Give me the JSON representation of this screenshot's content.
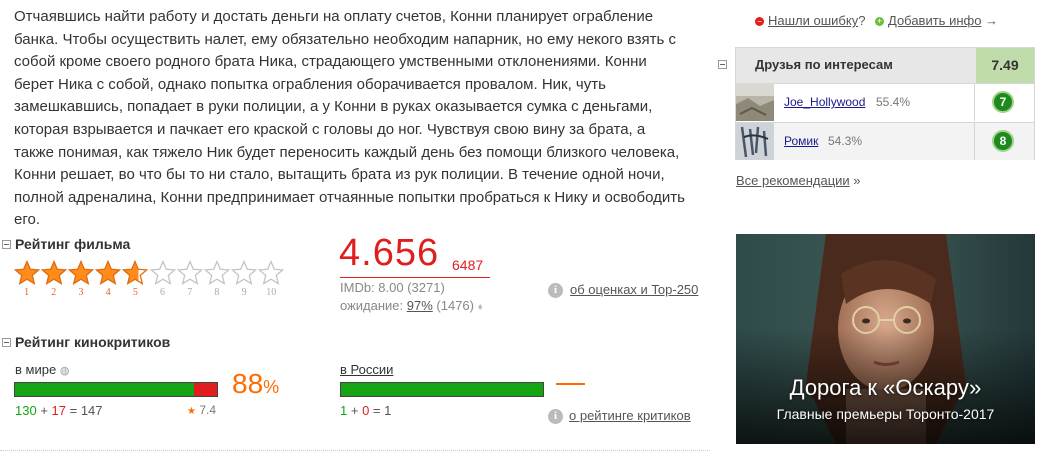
{
  "description": "Отчаявшись найти работу и достать деньги на оплату счетов, Конни планирует ограбление банка. Чтобы осуществить налет, ему обязательно необходим напарник, но ему некого взять с собой кроме своего родного брата Ника, страдающего умственными отклонениями. Конни берет Ника с собой, однако попытка ограбления оборачивается провалом. Ник, чуть замешкавшись, попадает в руки полиции, а у Конни в руках оказывается сумка с деньгами, которая взрывается и пачкает его краской с головы до ног. Чувствуя свою вину за брата, а также понимая, как тяжело Ник будет переносить каждый день без помощи близкого человека, Конни решает, во что бы то ни стало, вытащить брата из рук полиции. В течение одной ночи, полной адреналина, Конни предпринимает отчаянные попытки пробраться к Нику и освободить его.",
  "film_rating": {
    "title": "Рейтинг фильма",
    "stars_value": 4.656,
    "star_numbers": [
      "1",
      "2",
      "3",
      "4",
      "5",
      "6",
      "7",
      "8",
      "9",
      "10"
    ],
    "value": "4.656",
    "votes": "6487",
    "imdb": "IMDb: 8.00 (3271)",
    "wait_label": "ожидание: ",
    "wait_pct": "97%",
    "wait_count": " (1476) ",
    "wait_icon": "♦",
    "link_label": "об оценках и Top-250",
    "info_icon": "i"
  },
  "critics": {
    "title": "Рейтинг кинокритиков",
    "world_label": "в мире",
    "world_icon": "globe-icon",
    "world_positive": 130,
    "world_negative": 17,
    "world_total": 147,
    "world_pos_text": "130",
    "world_plus": " + ",
    "world_neg_text": "17",
    "world_eq": " = 147",
    "world_avg": "7.4",
    "world_pct": "88",
    "pct_sign": "%",
    "russia_label": "в России",
    "russia_pos_text": "1",
    "russia_plus": " + ",
    "russia_neg_text": "0",
    "russia_eq": " = 1",
    "russia_positive_fraction": 1.0,
    "link_label": "о рейтинге критиков"
  },
  "sidebar": {
    "report_label": "Нашли ошибку",
    "report_q": "?",
    "add_label": "Добавить инфо",
    "add_arrow": " →",
    "friends_title": "Друзья по интересам",
    "friends_score": "7.49",
    "friends": [
      {
        "name": "Joe_Hollywood",
        "pct": "55.4%",
        "rating": "7"
      },
      {
        "name": "Ромик",
        "pct": "54.3%",
        "rating": "8"
      }
    ],
    "all_recs": "Все рекомендации",
    "all_recs_arrow": " »"
  },
  "promo": {
    "title": "Дорога к «Оскару»",
    "subtitle": "Главные премьеры Торонто-2017"
  },
  "colors": {
    "rating_red": "#e01e1e",
    "star_orange": "#ff6b00",
    "critic_green": "#14a414"
  }
}
